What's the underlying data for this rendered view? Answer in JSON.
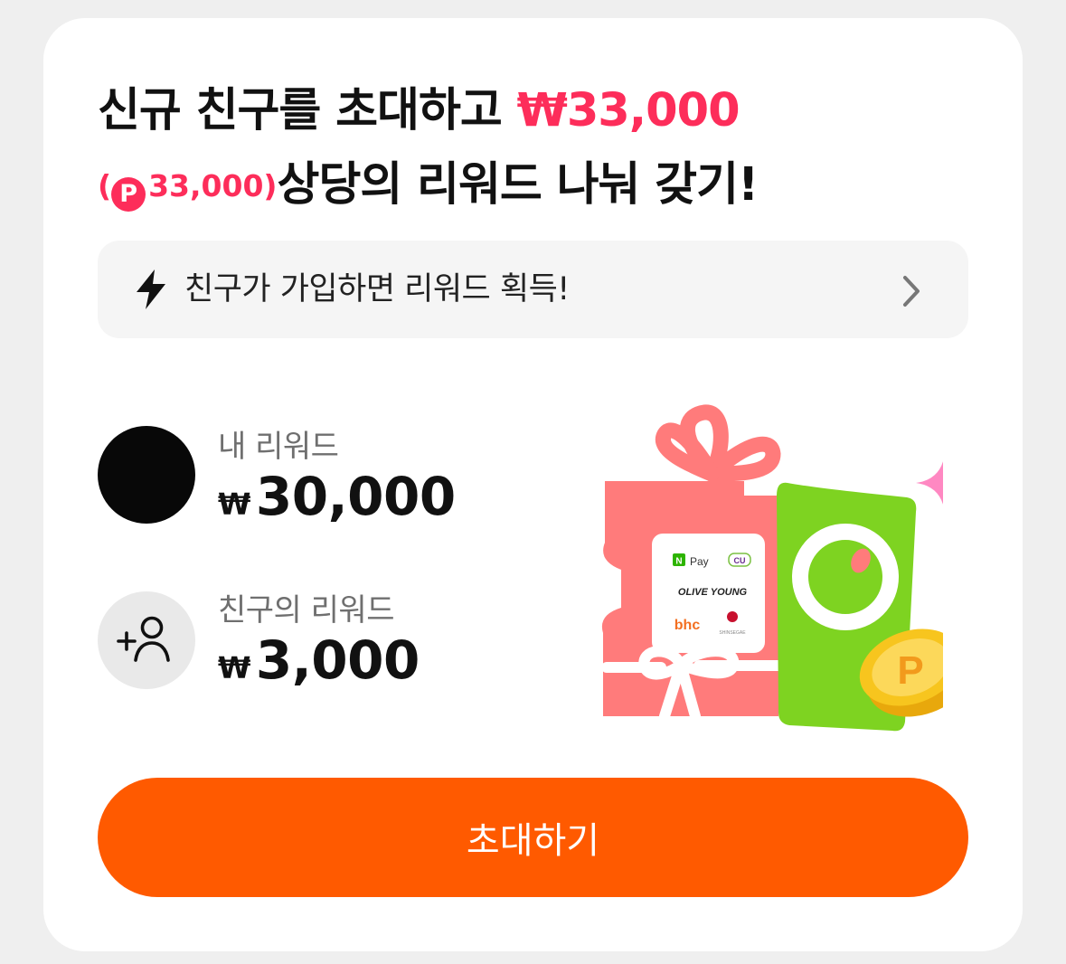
{
  "headline": {
    "part1": "신규 친구를 초대하고 ",
    "amount": "₩33,000",
    "point_open": "(",
    "point_icon_letter": "P",
    "point_amount": "33,000)",
    "part2": "상당의 리워드 나눠 갖기!"
  },
  "banner": {
    "icon": "lightning-bolt-icon",
    "text": "친구가 가입하면 리워드 획득!",
    "chevron": "chevron-right-icon"
  },
  "rewards": {
    "mine": {
      "label": "내 리워드",
      "currency": "₩",
      "amount": "30,000"
    },
    "friend": {
      "label": "친구의 리워드",
      "currency": "₩",
      "amount": "3,000",
      "icon": "add-user-icon"
    }
  },
  "illustration": {
    "brands": [
      "N",
      "Pay",
      "CU",
      "OLIVE YOUNG",
      "bhc",
      "SHINSEGAE"
    ],
    "coin_letter": "P"
  },
  "cta": {
    "label": "초대하기"
  },
  "colors": {
    "accent_pink": "#fd2d5a",
    "cta_orange": "#ff5a00",
    "gift_red": "#ff7b7b",
    "card_green": "#7ed321",
    "coin_gold": "#f7c51e"
  }
}
